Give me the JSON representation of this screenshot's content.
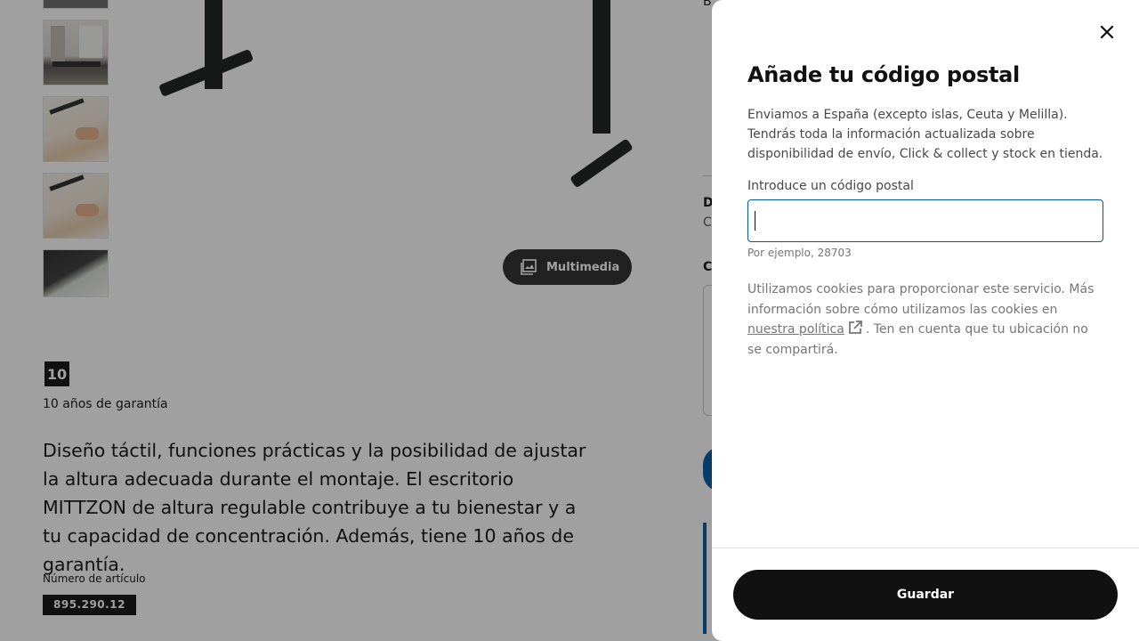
{
  "background": {
    "media_button": {
      "label": "Multimedia",
      "icon": "gallery-icon"
    },
    "warranty": {
      "badge": "10",
      "text": "10 años de garantía"
    },
    "description": "Diseño táctil, funciones prácticas y la posibilidad de ajustar la altura adecuada durante el montaje. El escritorio MITTZON de altura regulable contribuye a tu bienestar y a tu capacidad de concentración. Además, tiene 10 años de garantía.",
    "article": {
      "label": "Número de artículo",
      "number": "895.290.12"
    },
    "right_fragments": {
      "top": "B",
      "section_letter": "D",
      "section_sub": "C",
      "section2": "C"
    }
  },
  "modal": {
    "title": "Añade tu código postal",
    "intro": "Enviamos a España (excepto islas, Ceuta y Melilla). Tendrás toda la información actualizada sobre disponibilidad de envío, Click & collect y stock en tienda.",
    "input": {
      "label": "Introduce un código postal",
      "value": "",
      "hint": "Por ejemplo, 28703"
    },
    "cookies": {
      "before": "Utilizamos cookies para proporcionar este servicio. Más información sobre cómo utilizamos las cookies en ",
      "link": "nuestra política",
      "after": ". Ten en cuenta que tu ubicación no se compartirá."
    },
    "save_label": "Guardar",
    "close_icon": "close-icon"
  },
  "colors": {
    "overlay": "#111111",
    "accent_blue": "#0058a3",
    "button_black": "#111111"
  }
}
